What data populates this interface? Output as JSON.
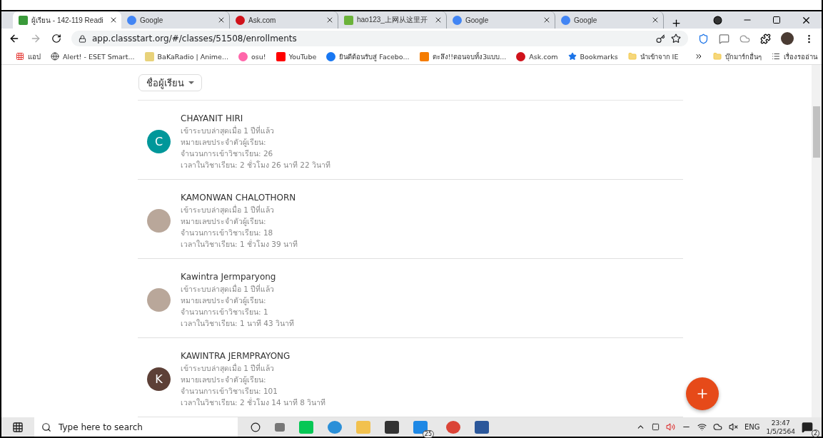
{
  "browser": {
    "tabs": [
      {
        "title": "ผู้เรียน - 142-119 Readi",
        "selected": true
      },
      {
        "title": "Google",
        "selected": false
      },
      {
        "title": "Ask.com",
        "selected": false
      },
      {
        "title": "hao123_上网从这里开",
        "selected": false
      },
      {
        "title": "Google",
        "selected": false
      },
      {
        "title": "Google",
        "selected": false
      }
    ],
    "url": "app.classstart.org/#/classes/51508/enrollments",
    "bookmarks": [
      "แอป",
      "Alert! - ESET Smart...",
      "BaKaRadio | Anime...",
      "osu!",
      "YouTube",
      "ยินดีต้อนรับสู่ Facebo...",
      "ตะลึง!!ตอนจบทั้ง3แบบ...",
      "Ask.com",
      "Bookmarks",
      "นำเข้าจาก IE"
    ],
    "bookmarks_right": [
      "บุ๊กมาร์กอื่นๆ",
      "เรื่องรออ่าน"
    ]
  },
  "page": {
    "sort_button": "ชื่อผู้เรียน",
    "students": [
      {
        "name": "CHAYANIT HIRI",
        "avatar": {
          "kind": "letter",
          "letter": "C",
          "color": "#00979a"
        },
        "lines": [
          "เข้าระบบล่าสุดเมื่อ 1 ปีที่แล้ว",
          "หมายเลขประจำตัวผู้เรียน:",
          "จำนวนการเข้าวิชาเรียน: 26",
          "เวลาในวิชาเรียน: 2 ชั่วโมง 26 นาที 22 วินาที"
        ]
      },
      {
        "name": "KAMONWAN CHALOTHORN",
        "avatar": {
          "kind": "photo"
        },
        "lines": [
          "เข้าระบบล่าสุดเมื่อ 1 ปีที่แล้ว",
          "หมายเลขประจำตัวผู้เรียน:",
          "จำนวนการเข้าวิชาเรียน: 18",
          "เวลาในวิชาเรียน: 1 ชั่วโมง 39 นาที"
        ]
      },
      {
        "name": "Kawintra Jermparyong",
        "avatar": {
          "kind": "photo"
        },
        "lines": [
          "เข้าระบบล่าสุดเมื่อ 1 ปีที่แล้ว",
          "หมายเลขประจำตัวผู้เรียน:",
          "จำนวนการเข้าวิชาเรียน: 1",
          "เวลาในวิชาเรียน: 1 นาที 43 วินาที"
        ]
      },
      {
        "name": "KAWINTRA JERMPRAYONG",
        "avatar": {
          "kind": "letter",
          "letter": "K",
          "color": "#5d4037"
        },
        "lines": [
          "เข้าระบบล่าสุดเมื่อ 1 ปีที่แล้ว",
          "หมายเลขประจำตัวผู้เรียน:",
          "จำนวนการเข้าวิชาเรียน: 101",
          "เวลาในวิชาเรียน: 2 ชั่วโมง 14 นาที 8 วินาที"
        ]
      }
    ]
  },
  "taskbar": {
    "search_placeholder": "Type here to search",
    "mail_badge": "25",
    "language": "ENG",
    "time": "23:47",
    "date": "1/5/2564",
    "notification_badge": "2"
  }
}
